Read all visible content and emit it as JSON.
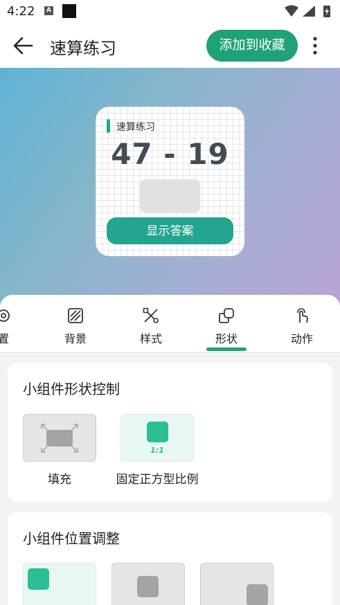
{
  "status_bar": {
    "time": "4:22",
    "a_icon": "A"
  },
  "app_bar": {
    "title": "速算练习",
    "favorite_button": "添加到收藏",
    "icons": {
      "back": "arrow-left-icon",
      "more": "more-vert-icon"
    }
  },
  "widget_preview": {
    "title": "速算练习",
    "expression": "47 - 19",
    "show_answer_button": "显示答案",
    "colors": {
      "accent": "#23a58f",
      "background_gradient": [
        "#5fb3d6",
        "#b9a4d6"
      ]
    }
  },
  "tabs": {
    "items": [
      {
        "label": "置",
        "icon": "settings-icon"
      },
      {
        "label": "背景",
        "icon": "background-icon"
      },
      {
        "label": "样式",
        "icon": "style-tools-icon"
      },
      {
        "label": "形状",
        "icon": "shapes-icon"
      },
      {
        "label": "动作",
        "icon": "tap-gesture-icon"
      }
    ],
    "selected": "形状"
  },
  "shape_card": {
    "title": "小组件形状控制",
    "options": [
      {
        "label": "填充",
        "icon": "fill-expand-icon",
        "selected": false
      },
      {
        "label": "固定正方型比例",
        "icon": "square-ratio-icon",
        "badge": "1:1",
        "selected": true
      }
    ]
  },
  "position_card": {
    "title": "小组件位置调整",
    "options": [
      {
        "icon": "position-top-left-icon",
        "selected": true
      },
      {
        "icon": "position-center-icon",
        "selected": false
      },
      {
        "icon": "position-bottom-right-icon",
        "selected": false
      }
    ]
  },
  "theme": {
    "primary": "#1fa277",
    "widget_accent": "#23a58f",
    "selected_bg": "#e9f7f2",
    "unselected_bg": "#e6e6e6"
  }
}
